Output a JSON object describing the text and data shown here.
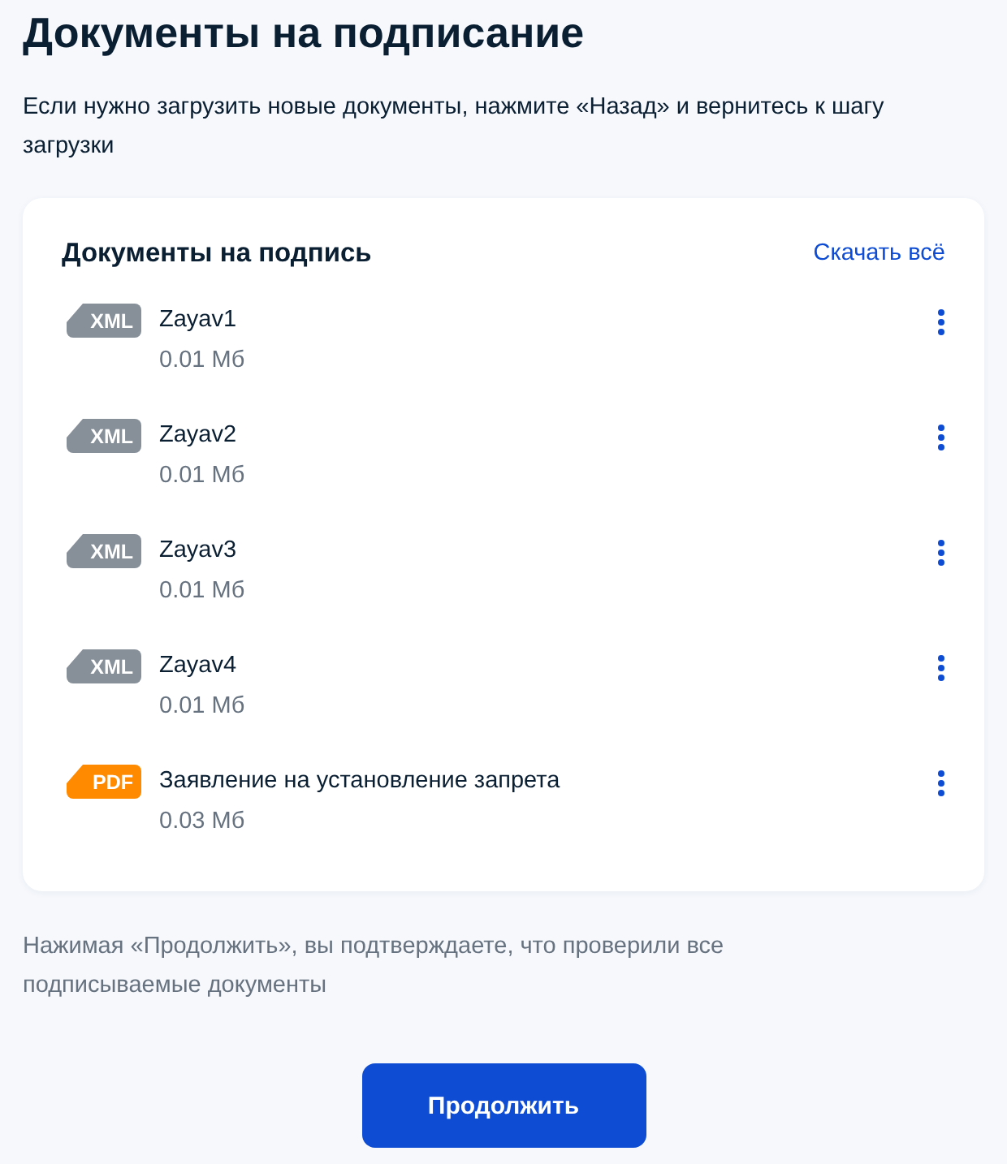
{
  "title": "Документы на подписание",
  "intro": "Если нужно загрузить новые документы, нажмите «Назад» и вернитесь к шагу загрузки",
  "documents_card": {
    "heading": "Документы на подпись",
    "download_all": "Скачать всё",
    "files": [
      {
        "kind": "xml",
        "badge": "XML",
        "name": "Zayav1",
        "size": "0.01 Мб"
      },
      {
        "kind": "xml",
        "badge": "XML",
        "name": "Zayav2",
        "size": "0.01 Мб"
      },
      {
        "kind": "xml",
        "badge": "XML",
        "name": "Zayav3",
        "size": "0.01 Мб"
      },
      {
        "kind": "xml",
        "badge": "XML",
        "name": "Zayav4",
        "size": "0.01 Мб"
      },
      {
        "kind": "pdf",
        "badge": "PDF",
        "name": "Заявление на установление запрета",
        "size": "0.03 Мб"
      }
    ]
  },
  "notice": "Нажимая «Продолжить», вы подтверждаете, что проверили все подписываемые документы",
  "continue_button": "Продолжить"
}
